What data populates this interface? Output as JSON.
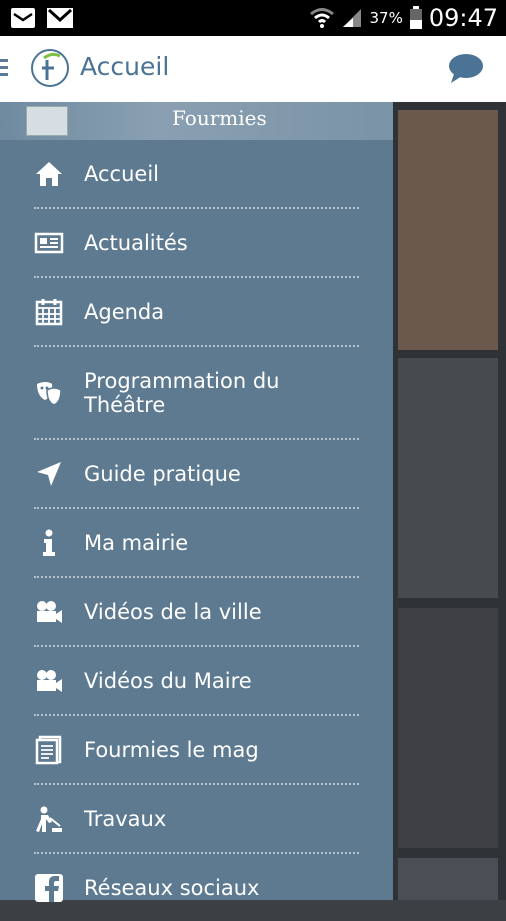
{
  "status_bar": {
    "battery": "37%",
    "time": "09:47"
  },
  "app_bar": {
    "title": "Accueil"
  },
  "drawer": {
    "banner_logo": "Fourmies",
    "items": [
      {
        "label": "Accueil",
        "icon": "home-icon"
      },
      {
        "label": "Actualités",
        "icon": "newspaper-icon"
      },
      {
        "label": "Agenda",
        "icon": "calendar-icon"
      },
      {
        "label": "Programmation du Théâtre",
        "icon": "theatre-masks-icon"
      },
      {
        "label": "Guide pratique",
        "icon": "location-arrow-icon"
      },
      {
        "label": "Ma mairie",
        "icon": "info-icon"
      },
      {
        "label": "Vidéos de la ville",
        "icon": "video-camera-icon"
      },
      {
        "label": "Vidéos du Maire",
        "icon": "video-camera-icon"
      },
      {
        "label": "Fourmies le mag",
        "icon": "magazine-icon"
      },
      {
        "label": "Travaux",
        "icon": "worker-icon"
      },
      {
        "label": "Réseaux sociaux",
        "icon": "facebook-icon"
      }
    ]
  },
  "colors": {
    "drawer_bg": "#5d7a91",
    "app_bar_title": "#4a7395",
    "accent_green": "#7cc043"
  }
}
